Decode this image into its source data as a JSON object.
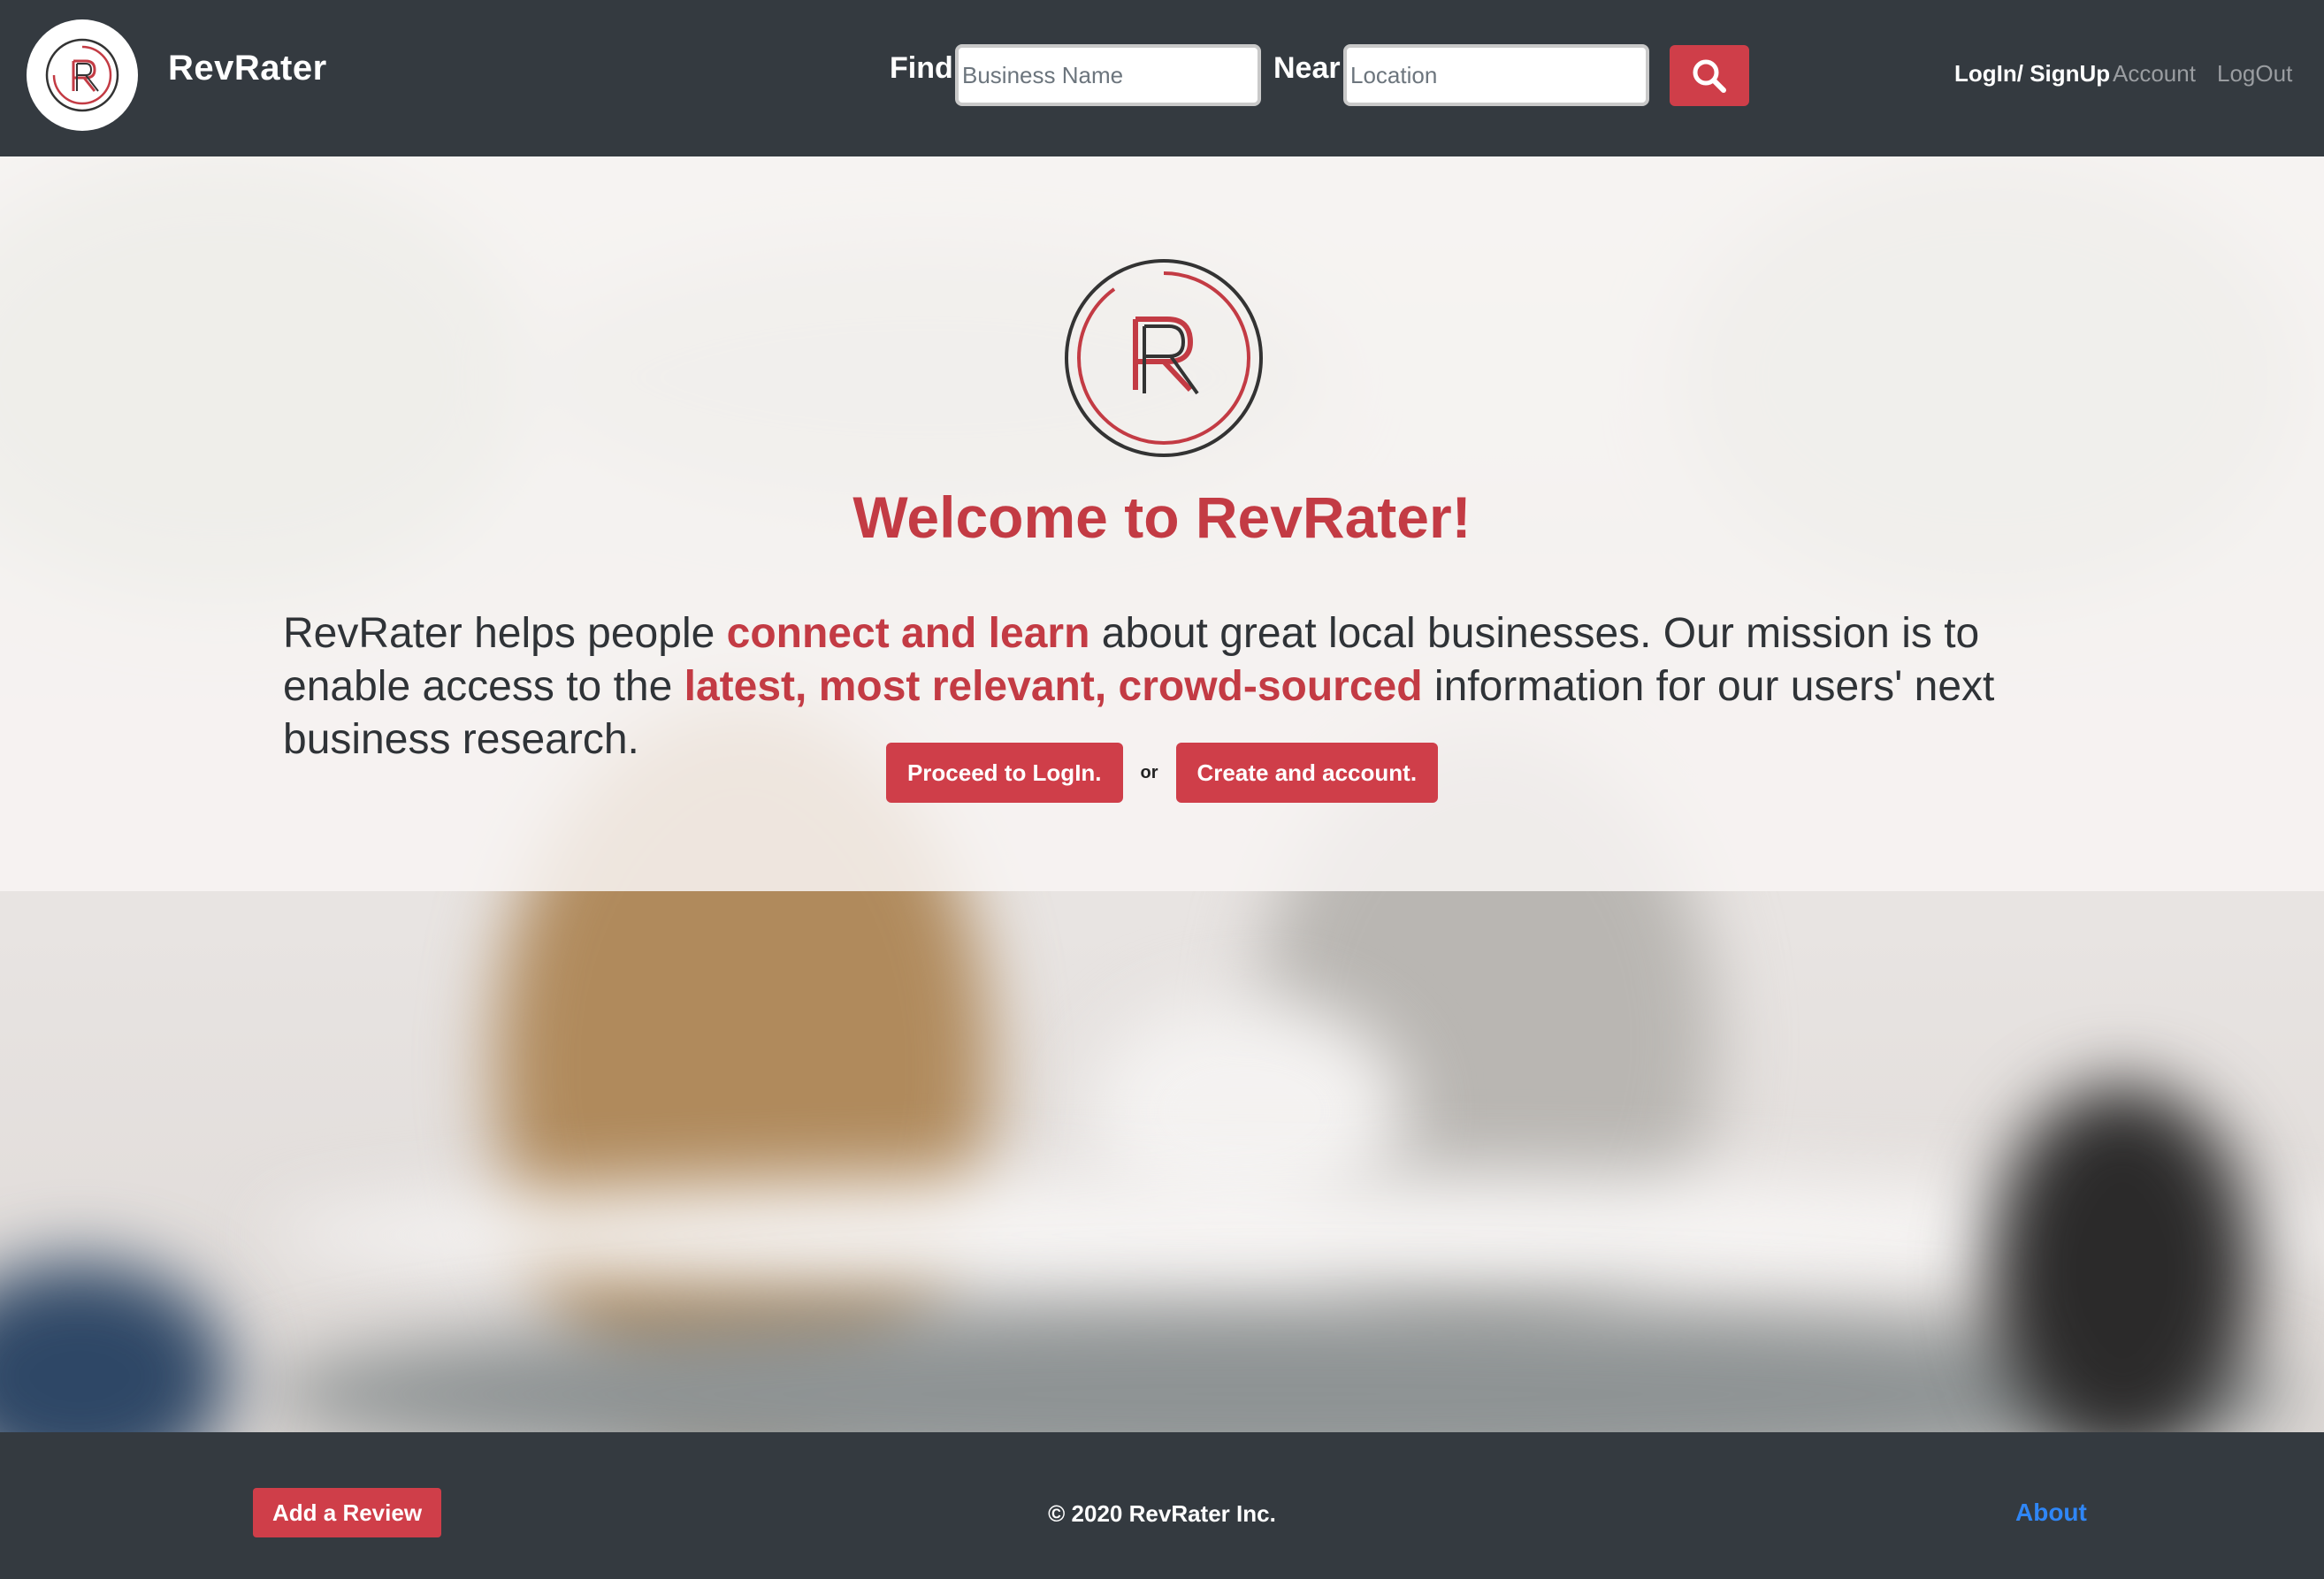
{
  "brand": {
    "name": "RevRater",
    "logo_letters": "R"
  },
  "search": {
    "find_label": "Find",
    "find_placeholder": "Business Name",
    "near_label": "Near",
    "near_placeholder": "Location",
    "button_icon": "search-icon"
  },
  "nav": {
    "login_signup": "LogIn/ SignUp",
    "account": "Account",
    "logout": "LogOut"
  },
  "hero": {
    "welcome": "Welcome to RevRater!",
    "mission_parts": [
      "RevRater helps people ",
      "connect and learn",
      " about great local businesses. Our mission is to enable access to the ",
      "latest, most relevant, crowd-sourced",
      " information for our users' next business research."
    ],
    "login_button": "Proceed to LogIn.",
    "or_text": "or",
    "create_button": "Create and account."
  },
  "footer": {
    "add_review": "Add a Review",
    "copyright": "© 2020 RevRater Inc.",
    "about": "About"
  },
  "colors": {
    "accent": "#cf3e49",
    "header_bg": "#343a40",
    "link_blue": "#2f86f6"
  }
}
